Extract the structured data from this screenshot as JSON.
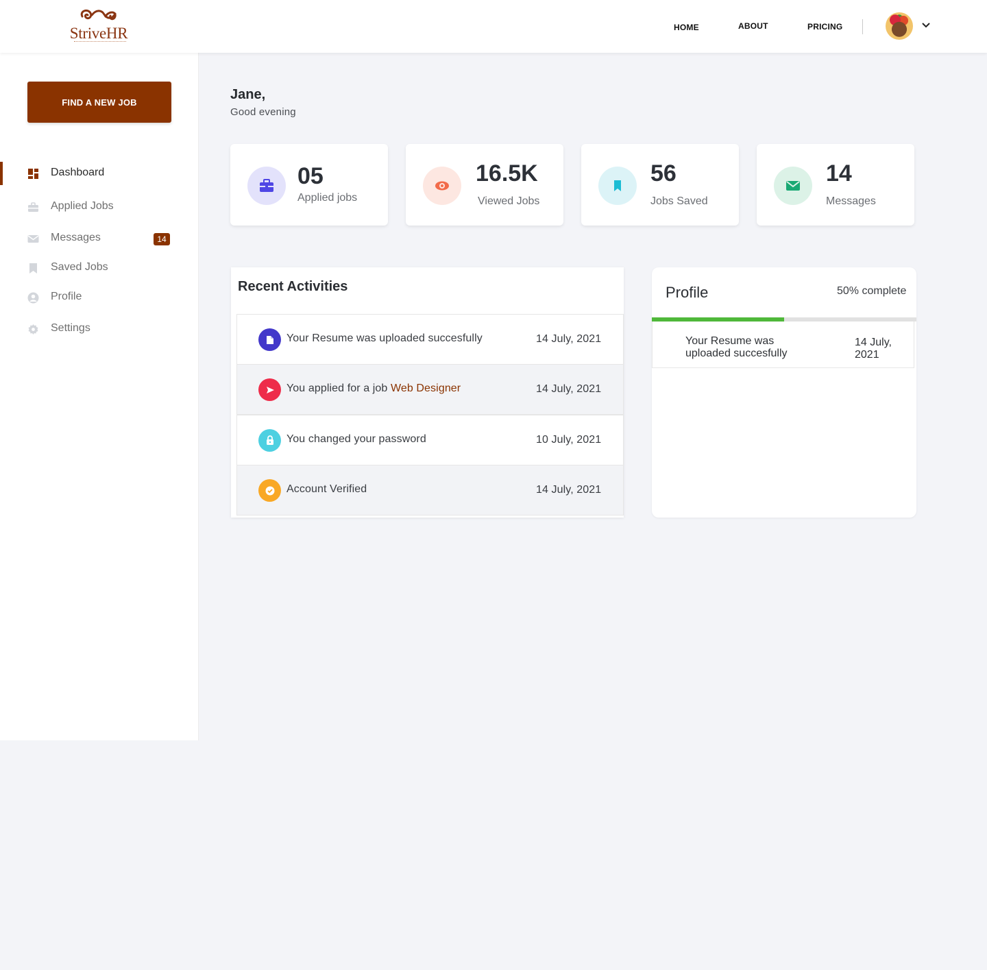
{
  "header": {
    "logo_text": "StriveHR",
    "nav": [
      "HOME",
      "ABOUT",
      "PRICING"
    ]
  },
  "sidebar": {
    "cta_label": "FIND A NEW JOB",
    "items": [
      {
        "label": "Dashboard",
        "icon": "dashboard-icon"
      },
      {
        "label": "Applied Jobs",
        "icon": "briefcase-icon"
      },
      {
        "label": "Messages",
        "icon": "mail-icon",
        "badge": "14"
      },
      {
        "label": "Saved Jobs",
        "icon": "bookmark-icon"
      },
      {
        "label": "Profile",
        "icon": "user-icon"
      },
      {
        "label": "Settings",
        "icon": "gear-icon"
      }
    ]
  },
  "greeting": {
    "name": "Jane,",
    "subtitle": "Good evening"
  },
  "stats": [
    {
      "value": "05",
      "label": "Applied jobs",
      "icon": "briefcase-icon",
      "color": "#4f46e5"
    },
    {
      "value": "16.5K",
      "label": "Viewed Jobs",
      "icon": "eye-icon",
      "color": "#f26b4a"
    },
    {
      "value": "56",
      "label": "Jobs Saved",
      "icon": "bookmark-icon",
      "color": "#1bbcd4"
    },
    {
      "value": "14",
      "label": "Messages",
      "icon": "mail-icon",
      "color": "#19a974"
    }
  ],
  "recent": {
    "title": "Recent Activities",
    "items": [
      {
        "text": "Your Resume was uploaded succesfully",
        "date": "14 July, 2021",
        "icon": "document-icon",
        "color": "#4338ca"
      },
      {
        "text": "You applied for a job ",
        "link": "Web Designer",
        "date": "14 July, 2021",
        "icon": "send-icon",
        "color": "#ee2c4a"
      },
      {
        "text": "You changed your password",
        "date": "10 July, 2021",
        "icon": "lock-icon",
        "color": "#4dd0e1"
      },
      {
        "text": "Account Verified",
        "date": "14 July, 2021",
        "icon": "check-icon",
        "color": "#f9a825"
      }
    ]
  },
  "profile": {
    "title": "Profile",
    "completion_text": "50% complete",
    "completion": 0.5,
    "items": [
      {
        "text": "Your Resume was uploaded succesfully",
        "date": "14 July, 2021"
      }
    ]
  },
  "colors": {
    "brand": "#8a3300",
    "progress": "#4fb83a"
  }
}
